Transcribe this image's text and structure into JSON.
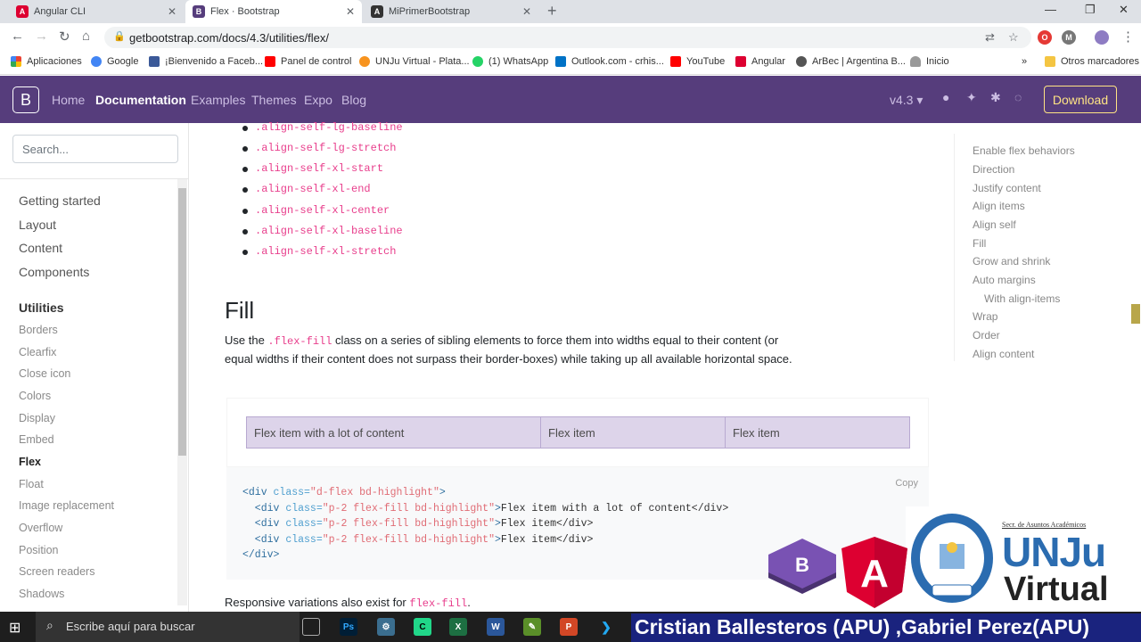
{
  "browser": {
    "tabs": [
      {
        "title": "Angular CLI",
        "icon": "angular-icon",
        "color": "#dd0031"
      },
      {
        "title": "Flex · Bootstrap",
        "icon": "bootstrap-icon",
        "color": "#563d7c"
      },
      {
        "title": "MiPrimerBootstrap",
        "icon": "angular-icon",
        "color": "#333333"
      }
    ],
    "url": "getbootstrap.com/docs/4.3/utilities/flex/",
    "bookmarks": [
      {
        "label": "Aplicaciones",
        "icon": "apps-icon"
      },
      {
        "label": "Google",
        "icon": "google-icon"
      },
      {
        "label": "¡Bienvenido a Faceb...",
        "icon": "facebook-icon"
      },
      {
        "label": "Panel de control",
        "icon": "youtube-icon"
      },
      {
        "label": "UNJu Virtual - Plata...",
        "icon": "moodle-icon"
      },
      {
        "label": "(1) WhatsApp",
        "icon": "whatsapp-icon"
      },
      {
        "label": "Outlook.com - crhis...",
        "icon": "outlook-icon"
      },
      {
        "label": "YouTube",
        "icon": "youtube-icon"
      },
      {
        "label": "Angular",
        "icon": "angular-icon"
      },
      {
        "label": "ArBec | Argentina B...",
        "icon": "globe-icon"
      },
      {
        "label": "Inicio",
        "icon": "cloud-icon"
      }
    ],
    "more_bookmarks": "»",
    "other_bookmarks": "Otros marcadores"
  },
  "navbar": {
    "logo": "B",
    "links": [
      "Home",
      "Documentation",
      "Examples",
      "Themes",
      "Expo",
      "Blog"
    ],
    "active": "Documentation",
    "version": "v4.3 ▾",
    "download": "Download",
    "accent": "#563d7c"
  },
  "sidebar": {
    "search_placeholder": "Search...",
    "sections": [
      "Getting started",
      "Layout",
      "Content",
      "Components",
      "Utilities"
    ],
    "active_section": "Utilities",
    "items": [
      "Borders",
      "Clearfix",
      "Close icon",
      "Colors",
      "Display",
      "Embed",
      "Flex",
      "Float",
      "Image replacement",
      "Overflow",
      "Position",
      "Screen readers",
      "Shadows"
    ],
    "active_item": "Flex"
  },
  "content": {
    "class_list": [
      ".align-self-lg-baseline",
      ".align-self-lg-stretch",
      ".align-self-xl-start",
      ".align-self-xl-end",
      ".align-self-xl-center",
      ".align-self-xl-baseline",
      ".align-self-xl-stretch"
    ],
    "heading": "Fill",
    "para_before": "Use the ",
    "para_code": ".flex-fill",
    "para_after": " class on a series of sibling elements to force them into widths equal to their content (or equal widths if their content does not surpass their border-boxes) while taking up all available horizontal space.",
    "example_items": [
      "Flex item with a lot of content",
      "Flex item",
      "Flex item"
    ],
    "copy_label": "Copy",
    "code_lines": [
      {
        "tag_open": "<div",
        "attr": " class=",
        "str": "\"d-flex bd-highlight\"",
        "rest": ">",
        "text": ""
      },
      {
        "tag_open": "  <div",
        "attr": " class=",
        "str": "\"p-2 flex-fill bd-highlight\"",
        "rest": ">",
        "text": "Flex item with a lot of content</div>"
      },
      {
        "tag_open": "  <div",
        "attr": " class=",
        "str": "\"p-2 flex-fill bd-highlight\"",
        "rest": ">",
        "text": "Flex item</div>"
      },
      {
        "tag_open": "  <div",
        "attr": " class=",
        "str": "\"p-2 flex-fill bd-highlight\"",
        "rest": ">",
        "text": "Flex item</div>"
      },
      {
        "tag_open": "</div>",
        "attr": "",
        "str": "",
        "rest": "",
        "text": ""
      }
    ],
    "responsive_before": "Responsive variations also exist for ",
    "responsive_code": "flex-fill",
    "responsive_after": "."
  },
  "toc": [
    "Enable flex behaviors",
    "Direction",
    "Justify content",
    "Align items",
    "Align self",
    "Fill",
    "Grow and shrink",
    "Auto margins",
    "With align-items",
    "Wrap",
    "Order",
    "Align content"
  ],
  "taskbar": {
    "search_placeholder": "Escribe aquí para buscar"
  },
  "overlay": {
    "banner": "Cristian Ballesteros (APU) ,Gabriel Perez(APU)",
    "secr": "Secr. de Asuntos Académicos",
    "unju": "UNJu",
    "virtual": "Virtual"
  }
}
